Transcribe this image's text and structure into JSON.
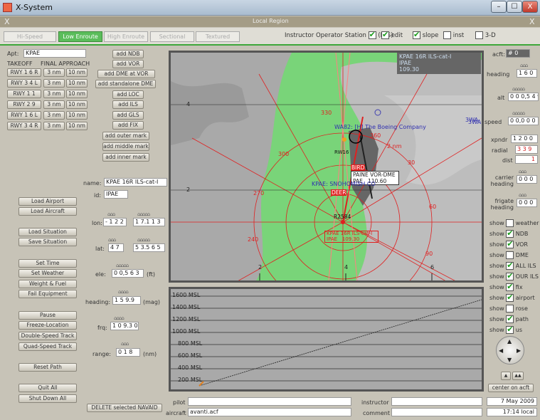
{
  "window": {
    "title": "X-System",
    "minimize": "–",
    "maximize": "☐",
    "close": "X"
  },
  "strip": {
    "close": "X",
    "title": "Local Region",
    "close_right": "X"
  },
  "tabs": [
    "Hi-Speed",
    "Low Enroute",
    "High Enroute",
    "Sectional",
    "Textured"
  ],
  "active_tab": "Low Enroute",
  "top_options": [
    {
      "label": "Instructor Operator Station",
      "checked": true,
      "suffix": "(IOS)"
    },
    {
      "label": "edit",
      "checked": true
    },
    {
      "label": "slope",
      "checked": true
    },
    {
      "label": "inst",
      "checked": false
    },
    {
      "label": "3-D",
      "checked": false
    }
  ],
  "airport": {
    "label": "Apt:",
    "value": "KPAE",
    "takeoff": "TAKEOFF",
    "final": "FINAL APPROACH"
  },
  "runways": [
    {
      "rwy": "RWY 1 6 R",
      "a": "3 nm",
      "b": "10 nm"
    },
    {
      "rwy": "RWY 3 4 L",
      "a": "3 nm",
      "b": "10 nm"
    },
    {
      "rwy": "RWY 1 1",
      "a": "3 nm",
      "b": "10 nm"
    },
    {
      "rwy": "RWY 2 9",
      "a": "3 nm",
      "b": "10 nm"
    },
    {
      "rwy": "RWY 1 6 L",
      "a": "3 nm",
      "b": "10 nm"
    },
    {
      "rwy": "RWY 3 4 R",
      "a": "3 nm",
      "b": "10 nm"
    }
  ],
  "nav_buttons": [
    "add NDB",
    "add VOR",
    "add DME at VOR",
    "add standalone DME",
    "add LOC",
    "add ILS",
    "add GLS",
    "add FIX",
    "add outer mark",
    "add middle mark",
    "add inner mark"
  ],
  "navaid": {
    "name_label": "name:",
    "name": "KPAE 16R ILS-cat-I",
    "id_label": "id:",
    "id": "IPAE",
    "lon_label": "lon:",
    "lon_deg": "- 1 2 2",
    "lon_min": "1 7.1 1 3",
    "lat_label": "lat:",
    "lat_deg": "4 7",
    "lat_min": "5 3.5 6 5",
    "ele_label": "ele:",
    "ele": "0 0,5 6 3",
    "ele_unit": "(ft)",
    "heading_label": "heading:",
    "heading": "1 5 9.9",
    "heading_unit": "(mag)",
    "frq_label": "frq:",
    "frq": "1 0 9.3 0",
    "range_label": "range:",
    "range": "0 1 8",
    "range_unit": "(nm)"
  },
  "left_buttons": [
    "Load Airport",
    "Load Aircraft",
    "Load Situation",
    "Save Situation",
    "Set Time",
    "Set Weather",
    "Weight & Fuel",
    "Fail Equipment",
    "Pause",
    "Freeze-Location",
    "Double-Speed Track",
    "Quad-Speed Track",
    "Reset Path",
    "Quit All",
    "Shut Down All"
  ],
  "delete_button": "DELETE selected NAVAID",
  "map": {
    "info": [
      "KPAE 16R ILS-cat-I",
      "IPAE",
      "109.30"
    ],
    "boeing": "WA82: [H] The Boeing Company",
    "wa_label": "3WA",
    "runway_label": "RW16",
    "bird": "BIRD",
    "paine_name": "PAINE VOR-DME",
    "paine_id": "PAE",
    "paine_freq": "110.60",
    "kpae": "KPAE: SNOHOMISH CO",
    "deer": "DEER",
    "r2584": "R2584",
    "ils_box": [
      "KPAE 16R ILS-cat-I",
      "IPAE",
      "109.30"
    ],
    "nm": "2 nm",
    "compass": [
      "330",
      "360",
      "30",
      "300",
      "270",
      "240",
      "60",
      "90"
    ],
    "axis_left": [
      "4",
      "2"
    ],
    "axis_bottom": [
      "2",
      "4",
      "6"
    ]
  },
  "altitude_labels": [
    "1600 MSL",
    "1400 MSL",
    "1200 MSL",
    "1000 MSL",
    "800 MSL",
    "600 MSL",
    "400 MSL",
    "200 MSL"
  ],
  "right": {
    "acft_label": "acft:",
    "acft": "# 0",
    "heading_label": "heading",
    "heading": "1 6 0",
    "alt_label": "alt",
    "alt": "0 0 0,5 4 9",
    "speed_label": "speed",
    "speed": "0 0,0 0 0",
    "xpndr_label": "xpndr",
    "xpndr": "1 2 0 0",
    "radial_label": "radial",
    "radial": "3 3 9",
    "dist_label": "dist",
    "dist": "1",
    "carrier_label": "carrier heading",
    "carrier": "0 0 0",
    "frigate_label": "frigate heading",
    "frigate": "0 0 0",
    "show_label": "show",
    "shows": [
      {
        "label": "weather",
        "checked": false
      },
      {
        "label": "NDB",
        "checked": true
      },
      {
        "label": "VOR",
        "checked": true
      },
      {
        "label": "DME",
        "checked": false
      },
      {
        "label": "ALL ILS",
        "checked": true
      },
      {
        "label": "OUR ILS",
        "checked": true
      },
      {
        "label": "fix",
        "checked": true
      },
      {
        "label": "airport",
        "checked": true
      },
      {
        "label": "rose",
        "checked": false
      },
      {
        "label": "path",
        "checked": true
      },
      {
        "label": "us",
        "checked": true
      }
    ],
    "center_button": "center on acft"
  },
  "bottom": {
    "pilot_label": "pilot",
    "aircraft_label": "aircraft",
    "aircraft": "avanti.acf",
    "instructor_label": "instructor",
    "comment_label": "comment",
    "date": "7 May 2009",
    "time": "17:14 local"
  },
  "colors": {
    "accent": "#3ea73a",
    "map_land": "#79d479",
    "compass": "#e02020",
    "navaid": "#4040b0"
  }
}
